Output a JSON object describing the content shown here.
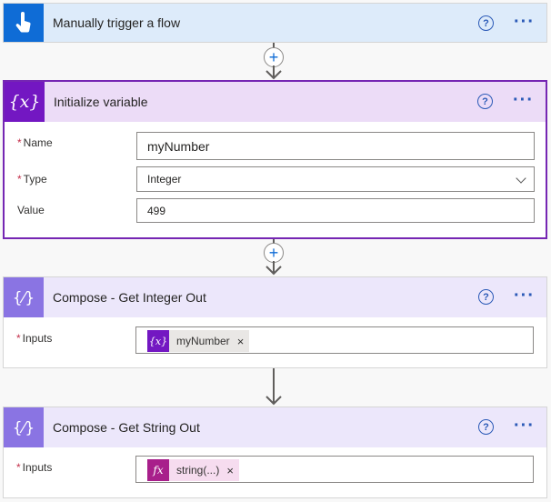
{
  "trigger": {
    "title": "Manually trigger a flow",
    "help": "?"
  },
  "init_var": {
    "title": "Initialize variable",
    "help": "?",
    "name_label": "Name",
    "name_value": "myNumber",
    "type_label": "Type",
    "type_value": "Integer",
    "value_label": "Value",
    "value_value": "499",
    "required_mark": "*"
  },
  "compose1": {
    "title": "Compose - Get Integer Out",
    "help": "?",
    "inputs_label": "Inputs",
    "token_label": "myNumber",
    "token_icon": "{x}",
    "token_remove": "×"
  },
  "compose2": {
    "title": "Compose - Get String Out",
    "help": "?",
    "inputs_label": "Inputs",
    "token_label": "string(...)",
    "token_icon": "fx",
    "token_remove": "×"
  },
  "more_glyph": "···",
  "icons": {
    "trigger": "touch-hand-icon",
    "variable": "variable-braces-icon",
    "compose": "compose-braces-icon"
  },
  "colors": {
    "trigger": "#0f6cd6",
    "variable": "#7317c2",
    "compose": "#8a74e3",
    "expression": "#a81f8b",
    "link": "#2b5ab7"
  }
}
